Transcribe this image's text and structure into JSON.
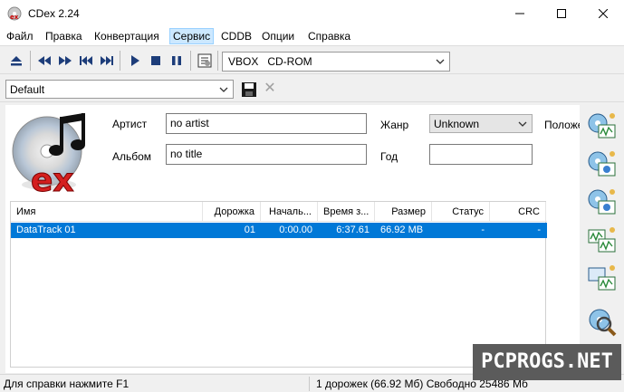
{
  "window": {
    "title": "CDex 2.24"
  },
  "menu": [
    "Файл",
    "Правка",
    "Конвертация",
    "Сервис",
    "CDDB",
    "Опции",
    "Справка"
  ],
  "toolbar": {
    "drive": "VBOX   CD-ROM"
  },
  "profile": {
    "value": "Default"
  },
  "fields": {
    "artist_label": "Артист",
    "artist_value": "no artist",
    "album_label": "Альбом",
    "album_value": "no title",
    "genre_label": "Жанр",
    "genre_value": "Unknown",
    "year_label": "Год",
    "year_value": "",
    "position_label": "Положе"
  },
  "table": {
    "headers": [
      "Имя",
      "Дорожка",
      "Началь...",
      "Время з...",
      "Размер",
      "Статус",
      "CRC"
    ],
    "rows": [
      [
        "DataTrack 01",
        "01",
        "0:00.00",
        "6:37.61",
        "66.92 MB",
        "-",
        "-"
      ]
    ]
  },
  "status": {
    "left": "Для справки нажмите F1",
    "right": "1 дорожек (66.92 Мб) Свободно 25486 Мб"
  },
  "watermark": "PCPROGS.NET"
}
